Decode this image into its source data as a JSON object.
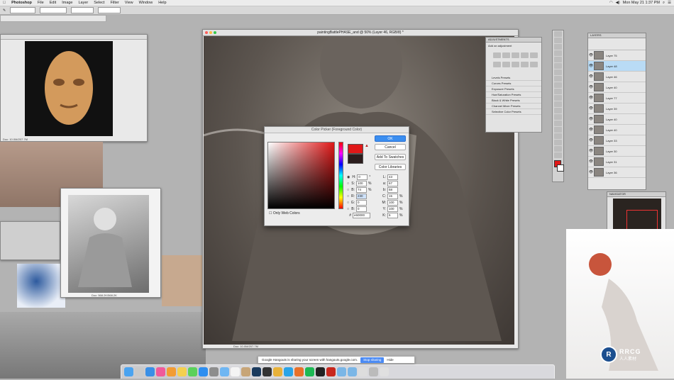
{
  "menubar": {
    "apple": "",
    "app": "Photoshop",
    "items": [
      "File",
      "Edit",
      "Image",
      "Layer",
      "Select",
      "Filter",
      "View",
      "Window",
      "Help"
    ],
    "datetime": "Mon May 21 1:37 PM"
  },
  "color_picker": {
    "title": "Color Picker (Foreground Color)",
    "ok": "OK",
    "cancel": "Cancel",
    "add_to_swatches": "Add To Swatches",
    "color_libraries": "Color Libraries",
    "only_web_colors": "Only Web Colors",
    "fields": {
      "H": "0",
      "S": "100",
      "B": "74",
      "R": "230",
      "G": "0",
      "Bv": "0",
      "L": "43",
      "a": "67",
      "b_lab": "58",
      "C": "15",
      "M": "100",
      "Y": "100",
      "K": "6"
    },
    "hex": "e60000",
    "new_color": "#e01818",
    "current_color": "#2b1d1d"
  },
  "main_doc": {
    "title": "paintingBattlePHASE_and @ 50% (Layer 46, RGB/8) *",
    "status": "Doc: 10.0M/207.7M"
  },
  "adjustments": {
    "title": "ADJUSTMENTS",
    "subtitle": "Add an adjustment",
    "presets": [
      "Levels Presets",
      "Curves Presets",
      "Exposure Presets",
      "Hue/Saturation Presets",
      "Black & White Presets",
      "Channel Mixer Presets",
      "Selective Color Presets"
    ]
  },
  "layers": {
    "title": "LAYERS",
    "rows": [
      "Layer 75",
      "Layer 48",
      "Layer 46",
      "Layer 40",
      "Layer 77",
      "Layer 39",
      "Layer 40",
      "Layer 40",
      "Layer 33",
      "Layer 30",
      "Layer 31",
      "Layer 36"
    ],
    "selected_index": 1
  },
  "navigator": {
    "title": "NAVIGATOR"
  },
  "hangouts": {
    "message": "Google Hangouts is sharing your screen with hangouts.google.com.",
    "stop": "Stop sharing",
    "hide": "Hide"
  },
  "ref_docs": {
    "mask_status": "Doc: 10.0M/207.7M",
    "boy_status": "Doc: 568.2K/568.2K"
  },
  "watermark": {
    "brand": "RRCG",
    "sub": "人人素材"
  }
}
